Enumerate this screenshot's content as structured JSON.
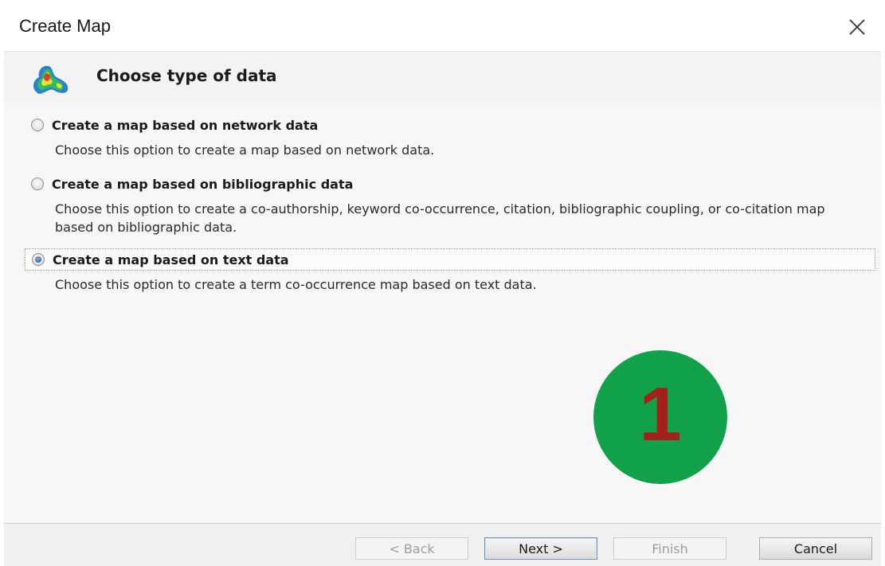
{
  "window": {
    "title": "Create Map"
  },
  "header": {
    "title": "Choose type of data",
    "icon": "density-map-icon"
  },
  "options": [
    {
      "label": "Create a map based on network data",
      "description": "Choose this option to create a map based on network data.",
      "selected": false
    },
    {
      "label": "Create a map based on bibliographic data",
      "description": "Choose this option to create a co-authorship, keyword co-occurrence, citation, bibliographic coupling, or co-citation map based on bibliographic data.",
      "selected": false
    },
    {
      "label": "Create a map based on text data",
      "description": "Choose this option to create a term co-occurrence map based on text data.",
      "selected": true
    }
  ],
  "badge": {
    "number": "1",
    "color": "#11a14a",
    "number_color": "#a6201b"
  },
  "buttons": {
    "back": "< Back",
    "next": "Next >",
    "finish": "Finish",
    "cancel": "Cancel"
  }
}
